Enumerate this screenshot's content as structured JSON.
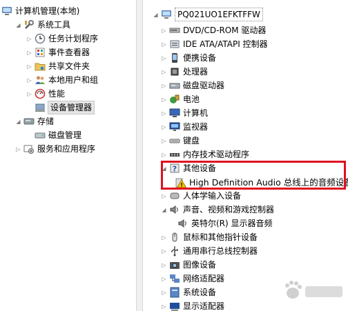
{
  "left_tree": {
    "root": "计算机管理(本地)",
    "system_tools": "系统工具",
    "task_scheduler": "任务计划程序",
    "event_viewer": "事件查看器",
    "shared_folders": "共享文件夹",
    "local_users": "本地用户和组",
    "performance": "性能",
    "device_manager": "设备管理器",
    "storage": "存储",
    "disk_management": "磁盘管理",
    "services_apps": "服务和应用程序"
  },
  "right_tree": {
    "host": "PQ021UO1EFKTFFW",
    "categories": [
      "DVD/CD-ROM 驱动器",
      "IDE ATA/ATAPI 控制器",
      "便携设备",
      "处理器",
      "磁盘驱动器",
      "电池",
      "计算机",
      "监视器",
      "键盘",
      "内存技术驱动程序",
      "其他设备",
      "High Definition Audio 总线上的音频设备",
      "人体学输入设备",
      "声音、视频和游戏控制器",
      "英特尔(R) 显示器音频",
      "鼠标和其他指针设备",
      "通用串行总线控制器",
      "图像设备",
      "网络适配器",
      "系统设备",
      "显示适配器"
    ]
  },
  "colors": {
    "highlight": "#e01020",
    "selection": "#e5e5e5",
    "warning": "#f5c400"
  }
}
